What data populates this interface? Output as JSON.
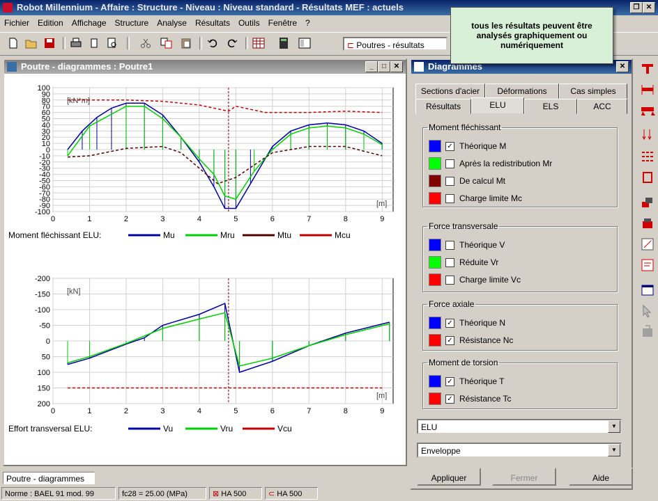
{
  "window": {
    "title": "Robot Millennium - Affaire : Structure - Niveau : Niveau standard - Résultats MEF : actuels"
  },
  "menu": [
    "Fichier",
    "Edition",
    "Affichage",
    "Structure",
    "Analyse",
    "Résultats",
    "Outils",
    "Fenêtre",
    "?"
  ],
  "toolbar": {
    "view_combo": "Poutres - résultats"
  },
  "tooltip": {
    "text": "tous les résultats peuvent être analysés graphiquement ou numériquement"
  },
  "child": {
    "title": "Poutre - diagrammes : Poutre1"
  },
  "dialog": {
    "title": "Diagrammes",
    "tabs_row1": [
      "Sections d'acier",
      "Déformations",
      "Cas simples"
    ],
    "tabs_row2": [
      "Résultats",
      "ELU",
      "ELS",
      "ACC"
    ],
    "active_tab": "ELU",
    "groups": [
      {
        "title": "Moment fléchissant",
        "items": [
          {
            "label": "Théorique M",
            "checked": true,
            "color": "#0000ff"
          },
          {
            "label": "Après la redistribution Mr",
            "checked": false,
            "color": "#00ff00"
          },
          {
            "label": "De calcul Mt",
            "checked": false,
            "color": "#800000"
          },
          {
            "label": "Charge limite Mc",
            "checked": false,
            "color": "#ff0000"
          }
        ]
      },
      {
        "title": "Force transversale",
        "items": [
          {
            "label": "Théorique V",
            "checked": false,
            "color": "#0000ff"
          },
          {
            "label": "Réduite Vr",
            "checked": false,
            "color": "#00ff00"
          },
          {
            "label": "Charge limite Vc",
            "checked": false,
            "color": "#ff0000"
          }
        ]
      },
      {
        "title": "Force axiale",
        "items": [
          {
            "label": "Théorique N",
            "checked": true,
            "color": "#0000ff"
          },
          {
            "label": "Résistance Nc",
            "checked": true,
            "color": "#ff0000"
          }
        ]
      },
      {
        "title": "Moment de torsion",
        "items": [
          {
            "label": "Théorique T",
            "checked": true,
            "color": "#0000ff"
          },
          {
            "label": "Résistance Tc",
            "checked": true,
            "color": "#ff0000"
          }
        ]
      }
    ],
    "combo1": "ELU",
    "combo2": "Enveloppe",
    "buttons": {
      "apply": "Appliquer",
      "close": "Fermer",
      "help": "Aide"
    }
  },
  "chart_data": [
    {
      "type": "line",
      "title": "",
      "ylabel": "[kN*m]",
      "xlabel": "[m]",
      "ylim": [
        100,
        -100
      ],
      "xlim": [
        0,
        9.3
      ],
      "yticks": [
        -100,
        -90,
        -80,
        -70,
        -60,
        -50,
        -40,
        -30,
        -20,
        -10,
        0,
        10,
        20,
        30,
        40,
        50,
        60,
        70,
        80,
        90,
        100
      ],
      "xticks": [
        0,
        1,
        2,
        3,
        4,
        5,
        6,
        7,
        8,
        9
      ],
      "legend_label": "Moment fléchissant ELU:",
      "series": [
        {
          "name": "Mu",
          "color": "#0000a0",
          "x": [
            0.4,
            0.8,
            1.2,
            1.6,
            2.0,
            2.5,
            3.0,
            3.5,
            4.0,
            4.4,
            4.7,
            5.0,
            5.4,
            6.0,
            6.5,
            7.0,
            7.5,
            8.0,
            8.5,
            9.0
          ],
          "y": [
            0,
            30,
            52,
            67,
            75,
            75,
            56,
            20,
            -20,
            -60,
            -95,
            -95,
            -55,
            5,
            30,
            40,
            43,
            40,
            30,
            10
          ]
        },
        {
          "name": "Mru",
          "color": "#00d000",
          "x": [
            0.4,
            1.0,
            2.0,
            2.5,
            3.0,
            3.5,
            4.0,
            4.4,
            4.7,
            5.0,
            5.5,
            6.0,
            6.5,
            7.0,
            7.5,
            8.0,
            8.5,
            9.0
          ],
          "y": [
            -10,
            38,
            70,
            70,
            50,
            20,
            -15,
            -40,
            -75,
            -80,
            -35,
            0,
            25,
            35,
            38,
            35,
            25,
            8
          ]
        },
        {
          "name": "Mtu",
          "color": "#500000",
          "x": [
            0.4,
            1.0,
            2.0,
            3.0,
            3.5,
            4.0,
            4.5,
            5.0,
            5.5,
            6.0,
            7.0,
            8.0,
            9.0
          ],
          "y": [
            -12,
            -10,
            2,
            5,
            -5,
            -30,
            -55,
            -45,
            -25,
            -5,
            5,
            5,
            -10
          ]
        },
        {
          "name": "Mcu",
          "color": "#c00000",
          "x": [
            0.4,
            1.0,
            2.0,
            3.0,
            4.0,
            4.8,
            5.0,
            5.8,
            6.5,
            7.0,
            8.0,
            9.0
          ],
          "y": [
            80,
            80,
            80,
            78,
            72,
            62,
            70,
            60,
            60,
            60,
            62,
            60
          ]
        }
      ]
    },
    {
      "type": "line",
      "title": "",
      "ylabel": "[kN]",
      "xlabel": "[m]",
      "ylim": [
        -200,
        200
      ],
      "xlim": [
        0,
        9.3
      ],
      "yticks": [
        200,
        150,
        100,
        50,
        0,
        -50,
        -100,
        -150,
        -200
      ],
      "xticks": [
        0,
        1,
        2,
        3,
        4,
        5,
        6,
        7,
        8,
        9
      ],
      "legend_label": "Effort transversal ELU:",
      "series": [
        {
          "name": "Vu",
          "color": "#0000a0",
          "x": [
            0.4,
            1.0,
            2.0,
            2.5,
            3.0,
            4.0,
            4.7,
            5.1,
            6.0,
            7.0,
            8.0,
            9.2
          ],
          "y": [
            75,
            55,
            10,
            -10,
            -50,
            -85,
            -120,
            100,
            65,
            15,
            -25,
            -60
          ]
        },
        {
          "name": "Vru",
          "color": "#00d000",
          "x": [
            0.4,
            1.0,
            2.0,
            3.0,
            4.0,
            4.7,
            5.1,
            6.0,
            7.0,
            8.0,
            9.2
          ],
          "y": [
            70,
            50,
            8,
            -40,
            -70,
            -90,
            80,
            55,
            15,
            -20,
            -55
          ]
        },
        {
          "name": "Vcu",
          "color": "#c00000",
          "x": [
            0.4,
            1.0,
            2.0,
            3.0,
            4.0,
            4.8,
            5.0,
            6.0,
            7.0,
            8.0,
            9.0
          ],
          "y": [
            150,
            150,
            150,
            150,
            150,
            150,
            150,
            150,
            150,
            150,
            150
          ]
        }
      ]
    }
  ],
  "status": {
    "pane": "Poutre - diagrammes",
    "norme": "Norme : BAEL 91 mod. 99",
    "fc28": "fc28 = 25.00 (MPa)",
    "steel1": "HA 500",
    "steel2": "HA 500"
  }
}
